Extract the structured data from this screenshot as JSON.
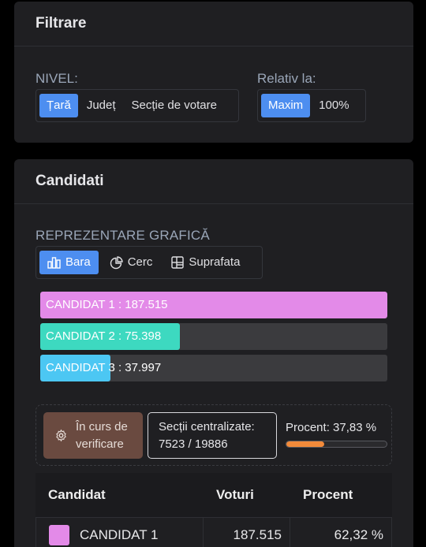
{
  "filter": {
    "title": "Filtrare",
    "nivel": {
      "label": "NIVEL:",
      "options": [
        "Țară",
        "Județ",
        "Secție de votare"
      ],
      "selected": "Țară"
    },
    "relativ": {
      "label": "Relativ la:",
      "options": [
        "Maxim",
        "100%"
      ],
      "selected": "Maxim"
    }
  },
  "candidati": {
    "title": "Candidati",
    "representation": {
      "label": "REPREZENTARE GRAFICĂ",
      "options": [
        "Bara",
        "Cerc",
        "Suprafata"
      ],
      "icons": [
        "bar-chart-icon",
        "pie-chart-icon",
        "grid-icon"
      ],
      "selected": "Bara"
    },
    "bars": [
      {
        "label": "CANDIDAT 1 : 187.515",
        "value": 187515,
        "color": "#e38ae8"
      },
      {
        "label": "CANDIDAT 2 : 75.398",
        "value": 75398,
        "color": "#3dd9c0"
      },
      {
        "label": "CANDIDAT 3 : 37.997",
        "value": 37997,
        "color": "#4cc7f3"
      }
    ],
    "bar_max": 187515,
    "status": {
      "button_label": "În curs de verificare",
      "centralizate_label": "Secții centralizate:",
      "centralizate_value": "7523 / 19886",
      "procent_label": "Procent: 37,83 %",
      "procent_value": 0.3783,
      "progress_color": "#f28a3a"
    },
    "table": {
      "headers": [
        "Candidat",
        "Voturi",
        "Procent"
      ],
      "rows": [
        {
          "name": "CANDIDAT 1",
          "votes": "187.515",
          "percent": "62,32 %",
          "color": "#e38ae8"
        }
      ]
    }
  }
}
